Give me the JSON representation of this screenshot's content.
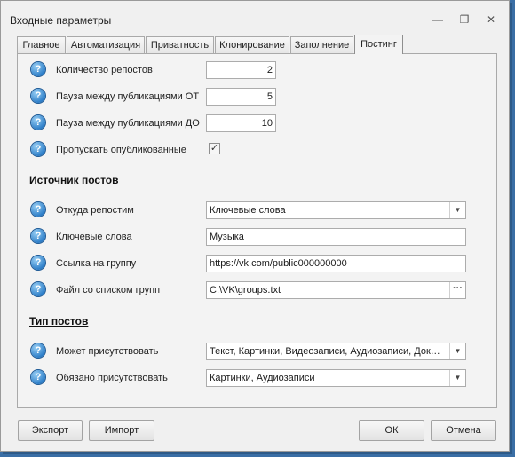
{
  "window": {
    "title": "Входные параметры",
    "minimize_glyph": "—",
    "restore_glyph": "❐",
    "close_glyph": "✕"
  },
  "tabs": [
    {
      "label": "Главное",
      "active": false
    },
    {
      "label": "Автоматизация",
      "active": false
    },
    {
      "label": "Приватность",
      "active": false
    },
    {
      "label": "Клонирование",
      "active": false
    },
    {
      "label": "Заполнение",
      "active": false
    },
    {
      "label": "Постинг",
      "active": true
    }
  ],
  "help_glyph": "?",
  "fields": {
    "repost_count": {
      "label": "Количество репостов",
      "value": "2"
    },
    "pause_from": {
      "label": "Пауза между публикациями ОТ",
      "value": "5"
    },
    "pause_to": {
      "label": "Пауза между публикациями ДО",
      "value": "10"
    },
    "skip_published": {
      "label": "Пропускать опубликованные",
      "checked": true,
      "check_glyph": "✓"
    }
  },
  "source_section": {
    "title": "Источник постов",
    "repost_from": {
      "label": "Откуда репостим",
      "value": "Ключевые слова"
    },
    "keywords": {
      "label": "Ключевые слова",
      "value": "Музыка"
    },
    "group_link": {
      "label": "Ссылка на группу",
      "value": "https://vk.com/public000000000"
    },
    "groups_file": {
      "label": "Файл со списком групп",
      "value": "C:\\VK\\groups.txt",
      "browse_glyph": "···"
    }
  },
  "post_type_section": {
    "title": "Тип постов",
    "may_contain": {
      "label": "Может присутствовать",
      "value": "Текст, Картинки, Видеозаписи, Аудиозаписи, Док…"
    },
    "must_contain": {
      "label": "Обязано присутствовать",
      "value": "Картинки, Аудиозаписи"
    }
  },
  "combo_arrow_glyph": "▼",
  "buttons": {
    "export": "Экспорт",
    "import": "Импорт",
    "ok": "ОК",
    "cancel": "Отмена"
  },
  "colors": {
    "accent": "#2e7fc9",
    "desktop": "#3a6ea5",
    "dialog_bg": "#f0f0f0"
  }
}
